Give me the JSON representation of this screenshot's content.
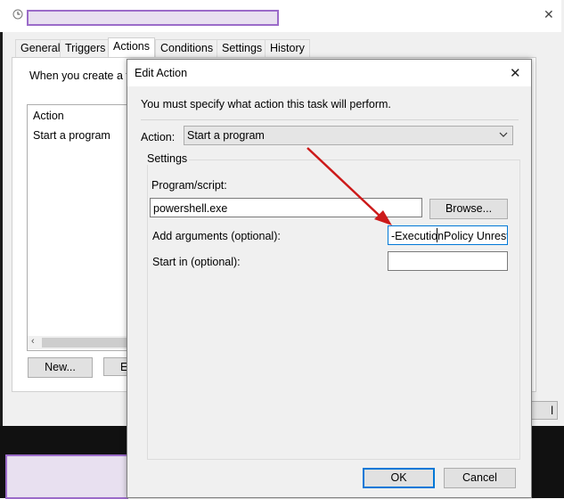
{
  "outer": {
    "tabs": [
      "General",
      "Triggers",
      "Actions",
      "Conditions",
      "Settings",
      "History"
    ],
    "active_tab": "Actions",
    "intro_text": "When you create a ta",
    "list_header": "Action",
    "list_item": "Start a program",
    "new_button": "New...",
    "edit_button_partial": "E",
    "right_button_partial": "l",
    "close_glyph": "✕"
  },
  "dialog": {
    "title": "Edit Action",
    "close_glyph": "✕",
    "instruction": "You must specify what action this task will perform.",
    "action_label": "Action:",
    "action_value": "Start a program",
    "settings_label": "Settings",
    "program_label": "Program/script:",
    "program_value": "powershell.exe",
    "browse_button": "Browse...",
    "arguments_label": "Add arguments (optional):",
    "arguments_value": "-ExecutionPolicy Unrestr",
    "startin_label": "Start in (optional):",
    "startin_value": "",
    "ok_button": "OK",
    "cancel_button": "Cancel"
  },
  "colors": {
    "annotation_arrow": "#cc1a1a",
    "redaction_fill": "#e8e0f0",
    "redaction_border": "#9b6bc9",
    "focus_border": "#0078d7"
  }
}
